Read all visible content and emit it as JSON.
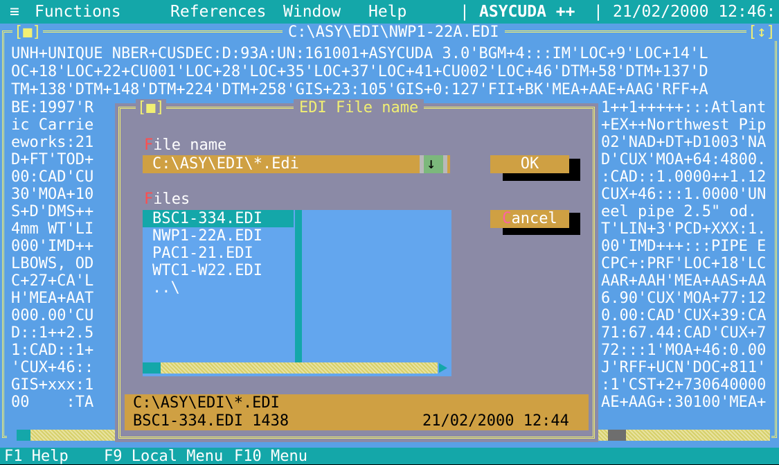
{
  "menubar": {
    "system_icon": "≡",
    "items": [
      "Functions",
      "References",
      "Window",
      "Help"
    ],
    "app_name": "ASYCUDA ++",
    "datetime": "21/02/2000 12:46:"
  },
  "editor": {
    "close_glyph": "[■]",
    "zoom_glyph": "[↕]",
    "title": "C:\\ASY\\EDI\\NWP1-22A.EDI",
    "lines": [
      "UNH+UNIQUE NBER+CUSDEC:D:93A:UN:161001+ASYCUDA 3.0'BGM+4:::IM'LOC+9'LOC+14'L",
      "OC+18'LOC+22+CU001'LOC+28'LOC+35'LOC+37'LOC+41+CU002'LOC+46'DTM+58'DTM+137'D",
      "TM+138'DTM+148'DTM+224'DTM+258'GIS+23:105'GIS+0:127'FII+BK'MEA+AAE+AAG'RFF+A"
    ],
    "left_col": [
      "BE:1997'R",
      "ic Carrie",
      "eworks:21",
      "D+FT'TOD+",
      "00:CAD'CU",
      "30'MOA+10",
      "S+D'DMS++",
      "4mm WT'LI",
      "000'IMD++",
      "LBOWS, OD",
      "C+27+CA'L",
      "H'MEA+AAT",
      "000.00'CU",
      "D::1++2.5",
      "1:CAD::1+",
      "'CUX+46::",
      "GIS+xxx:1",
      "00    :TA"
    ],
    "right_col": [
      "1++1+++++:::Atlant",
      "+EX++Northwest Pip",
      "02'NAD+DT+D1003'NA",
      "D'CUX'MOA+64:4800.",
      ":CAD::1.0000++1.12",
      "CUX+46:::1.0000'UN",
      "eel pipe 2.5\" od.",
      "T'LIN+3'PCD+XXX:1.",
      "00'IMD+++:::PIPE E",
      "CPC+:PRF'LOC+18'LC",
      "AAR+AAH'MEA+AAS+AA",
      "6.90'CUX'MOA+77:12",
      "0.00:CAD'CUX+39:CA",
      "71:67.44:CAD'CUX+7",
      "72:::1'MOA+46:0.00",
      "J'RFF+UCN'DOC+811'",
      ":1'CST+2+730640000",
      "AE+AAG+:30100'MEA+"
    ]
  },
  "dialog": {
    "close_glyph": "[■]",
    "title": "EDI File name",
    "file_name_label_hot": "F",
    "file_name_label_rest": "ile name",
    "file_name_value": "C:\\ASY\\EDI\\*.Edi",
    "dropdown_glyph": "↓",
    "files_label_hot": "F",
    "files_label_rest": "iles",
    "files": [
      "BSC1-334.EDI",
      "NWP1-22A.EDI",
      "PAC1-21.EDI",
      "WTC1-W22.EDI",
      "..\\"
    ],
    "selected_index": 0,
    "ok_label": "OK",
    "cancel_hot": "C",
    "cancel_rest": "ancel",
    "info_path": "C:\\ASY\\EDI\\*.EDI",
    "info_file": "BSC1-334.EDI 1438",
    "info_datetime": "21/02/2000 12:44"
  },
  "statusbar": {
    "items": [
      {
        "key": "F1",
        "label": "Help"
      },
      {
        "key": "F9",
        "label": "Local Menu"
      },
      {
        "key": "F10",
        "label": "Menu"
      }
    ]
  },
  "colors": {
    "menubar": "#14a7a9",
    "editor_bg": "#5aa0e6",
    "frame": "#f1ef73",
    "dialog_bg": "#8b8aa6",
    "gold": "#cfa043",
    "listbox": "#63a6ee",
    "selection": "#14a7a9"
  }
}
